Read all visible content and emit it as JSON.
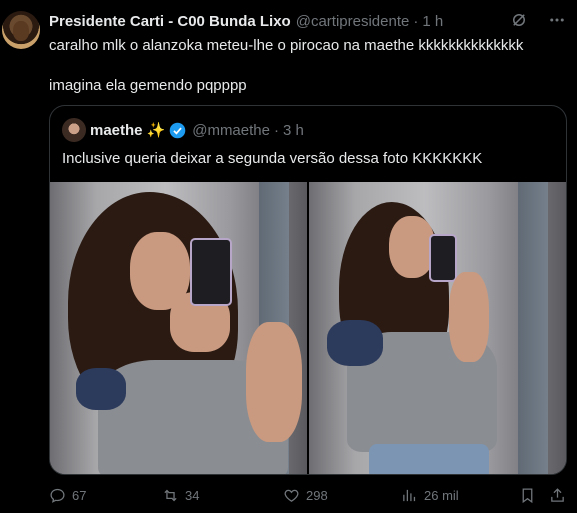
{
  "tweet": {
    "author_name": "Presidente Carti - C00 Bunda Lixo",
    "author_handle": "@cartipresidente",
    "separator": "·",
    "time": "1 h",
    "text_line1": "caralho mlk o alanzoka meteu-lhe o pirocao na maethe kkkkkkkkkkkkkk",
    "text_line2": "imagina ela gemendo pqpppp"
  },
  "quote": {
    "author_name": "maethe",
    "emoji": "✨",
    "author_handle": "@mmaethe",
    "separator": "·",
    "time": "3 h",
    "text": "Inclusive queria deixar a segunda versão dessa foto KKKKKKK",
    "verified_color": "#1d9bf0"
  },
  "actions": {
    "replies": "67",
    "retweets": "34",
    "likes": "298",
    "views": "26 mil"
  },
  "icons": {
    "grok": "grok-icon",
    "more": "more-icon",
    "reply": "reply-icon",
    "retweet": "retweet-icon",
    "like": "heart-icon",
    "views": "views-icon",
    "bookmark": "bookmark-icon",
    "share": "share-icon"
  }
}
